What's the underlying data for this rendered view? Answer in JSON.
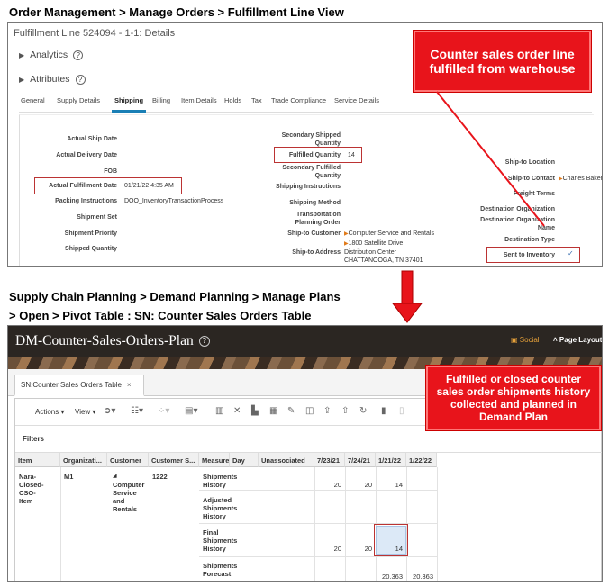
{
  "captions": {
    "order_management": "Order Management > Manage Orders > Fulfillment Line View",
    "supply_chain_line1": "Supply Chain Planning > Demand Planning > Manage Plans",
    "supply_chain_line2": "> Open > Pivot Table : SN: Counter Sales Orders Table"
  },
  "fulfillment": {
    "title": "Fulfillment Line 524094 - 1-1: Details",
    "analytics_label": "Analytics",
    "attributes_label": "Attributes",
    "tabs": [
      "General",
      "Supply Details",
      "Shipping",
      "Billing",
      "Item Details",
      "Holds",
      "Tax",
      "Trade Compliance",
      "Service Details"
    ],
    "active_tab": "Shipping",
    "col1": {
      "actual_ship_date": "Actual Ship Date",
      "actual_delivery_date": "Actual Delivery Date",
      "fob": "FOB",
      "actual_fulfillment_date": "Actual Fulfillment Date",
      "actual_fulfillment_date_value": "01/21/22 4:35 AM",
      "packing_instructions": "Packing Instructions",
      "packing_instructions_value": "DOO_InventoryTransactionProcess",
      "shipment_set": "Shipment Set",
      "shipment_priority": "Shipment Priority",
      "shipped_quantity": "Shipped Quantity"
    },
    "col2": {
      "secondary_shipped_quantity_1": "Secondary Shipped",
      "secondary_shipped_quantity_2": "Quantity",
      "fulfilled_quantity": "Fulfilled Quantity",
      "fulfilled_quantity_value": "14",
      "secondary_fulfilled_1": "Secondary Fulfilled",
      "secondary_fulfilled_2": "Quantity",
      "shipping_instructions": "Shipping Instructions",
      "shipping_method": "Shipping Method",
      "transportation_1": "Transportation",
      "transportation_2": "Planning Order",
      "ship_to_customer": "Ship-to Customer",
      "ship_to_customer_value": "Computer Service and Rentals",
      "ship_to_address": "Ship-to Address",
      "address_line1": "1800 Satellite Drive",
      "address_line2": "Distribution Center",
      "address_line3": "CHATTANOOGA, TN 37401"
    },
    "col3": {
      "ship_to_location": "Ship-to Location",
      "ship_to_contact": "Ship-to Contact",
      "ship_to_contact_value": "Charles Baker",
      "freight_terms": "Freight Terms",
      "destination_organization": "Destination Organization",
      "destination_org_name_1": "Destination Organization",
      "destination_org_name_2": "Name",
      "destination_type": "Destination Type",
      "sent_to_inventory": "Sent to Inventory"
    }
  },
  "callout_top": "Counter sales order line fulfilled from warehouse",
  "callout_bottom": "Fulfilled or closed counter sales order shipments history collected and planned in Demand Plan",
  "plan": {
    "title": "DM-Counter-Sales-Orders-Plan",
    "social_label": "Social",
    "page_layout_label": "Page Layout",
    "tab_label": "SN:Counter Sales Orders Table",
    "toolbar": {
      "actions": "Actions",
      "view": "View"
    },
    "filters_label": "Filters",
    "headers": [
      "Item",
      "Organizati...",
      "Customer",
      "Customer S...",
      "Measure",
      "Day",
      "Unassociated",
      "7/23/21",
      "7/24/21",
      "1/21/22",
      "1/22/22"
    ],
    "item": {
      "line1": "Nara-",
      "line2": "Closed-",
      "line3": "CSO-",
      "line4": "Item"
    },
    "organization": "M1",
    "customer": {
      "line1": "Computer",
      "line2": "Service",
      "line3": "and",
      "line4": "Rentals"
    },
    "customer_site": "1222",
    "measures": [
      {
        "line1": "Shipments",
        "line2": "History",
        "line3": "",
        "v1": "20",
        "v2": "20",
        "v3": "14",
        "v4": ""
      },
      {
        "line1": "Adjusted",
        "line2": "Shipments",
        "line3": "History",
        "v1": "",
        "v2": "",
        "v3": "",
        "v4": ""
      },
      {
        "line1": "Final",
        "line2": "Shipments",
        "line3": "History",
        "v1": "20",
        "v2": "20",
        "v3": "14",
        "v4": ""
      },
      {
        "line1": "Shipments",
        "line2": "Forecast",
        "line3": "",
        "v1": "",
        "v2": "",
        "v3": "20.363",
        "v4": "20.363"
      }
    ]
  }
}
